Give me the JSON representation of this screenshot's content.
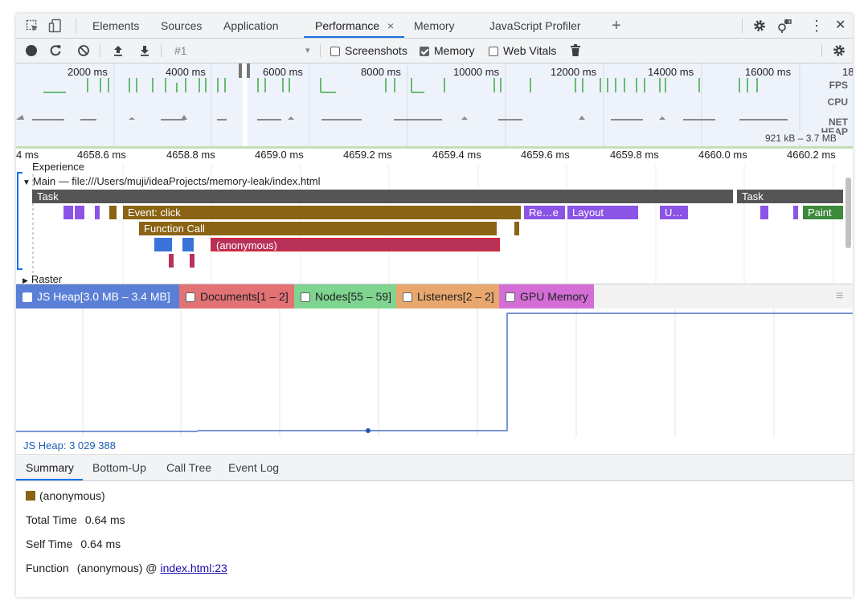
{
  "tabs": {
    "items": [
      "Elements",
      "Sources",
      "Application",
      "Performance",
      "Memory",
      "JavaScript Profiler"
    ],
    "close_glyph": "×",
    "add_glyph": "+",
    "close_panel_glyph": "✕",
    "more_glyph": "⋮"
  },
  "toolbar": {
    "profile_name": "#1",
    "dropdown_glyph": "▾",
    "screenshots_label": "Screenshots",
    "screenshots_checked": false,
    "memory_label": "Memory",
    "memory_checked": true,
    "web_vitals_label": "Web Vitals",
    "web_vitals_checked": false
  },
  "overview": {
    "time_labels": [
      "2000 ms",
      "4000 ms",
      "6000 ms",
      "8000 ms",
      "10000 ms",
      "12000 ms",
      "14000 ms",
      "16000 ms",
      "18"
    ],
    "fps_label": "FPS",
    "cpu_label": "CPU",
    "net_label": "NET",
    "heap_label": "HEAP",
    "heap_range": "921 kB – 3.7 MB"
  },
  "ruler": {
    "labels": [
      "4 ms",
      "4658.6 ms",
      "4658.8 ms",
      "4659.0 ms",
      "4659.2 ms",
      "4659.4 ms",
      "4659.6 ms",
      "4659.8 ms",
      "4660.0 ms",
      "4660.2 ms"
    ]
  },
  "flame": {
    "experience_label": "Experience",
    "main_label": "Main — file:///Users/muji/ideaProjects/memory-leak/index.html",
    "main_arrow": "▼",
    "raster_label": "Raster",
    "raster_arrow": "▶",
    "task_label": "Task",
    "task2_label": "Task",
    "event_click_label": "Event: click",
    "recalc_label": "Re…e",
    "layout_label": "Layout",
    "update_label": "U…",
    "paint_label": "Paint",
    "function_call_label": "Function Call",
    "anonymous_label": "(anonymous)"
  },
  "legend": {
    "js_heap": "JS Heap[3.0 MB – 3.4 MB]",
    "documents": "Documents[1 – 2]",
    "nodes": "Nodes[55 – 59]",
    "listeners": "Listeners[2 – 2]",
    "gpu_memory": "GPU Memory",
    "menu_glyph": "≡"
  },
  "js_heap_readout": "JS Heap: 3 029 388",
  "detail_tabs": [
    "Summary",
    "Bottom-Up",
    "Call Tree",
    "Event Log"
  ],
  "summary": {
    "title": "(anonymous)",
    "total_time_label": "Total Time",
    "total_time_value": "0.64 ms",
    "self_time_label": "Self Time",
    "self_time_value": "0.64 ms",
    "function_label": "Function",
    "function_value": "(anonymous) @",
    "function_link": "index.html:23"
  },
  "colors": {
    "accent": "#1a73e8",
    "task": "#555555",
    "event_click": "#8a6414",
    "function_call": "#8a6414",
    "anonymous": "#b83158",
    "layout": "#8c54e6",
    "paint": "#3d8a3a",
    "js_heap": "#5a7fd6",
    "documents": "#e27274",
    "nodes": "#7fd48f",
    "listeners": "#e8a86d",
    "gpu_memory": "#d46ed6"
  }
}
